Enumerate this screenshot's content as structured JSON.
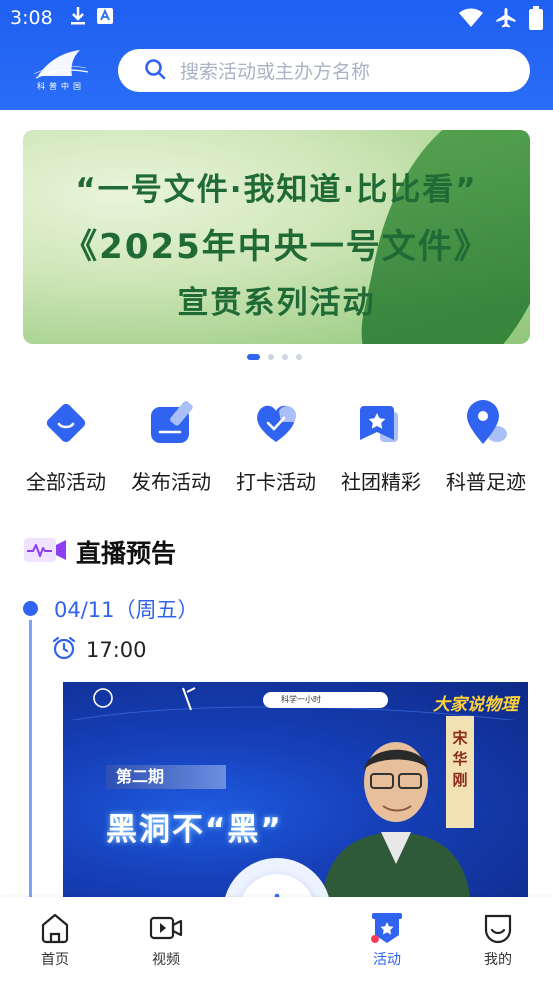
{
  "status_bar": {
    "time": "3:08"
  },
  "header": {
    "logo_text": "科普中国",
    "search": {
      "placeholder": "搜索活动或主办方名称"
    }
  },
  "banner": {
    "lines": [
      "“一号文件·我知道·比比看”",
      "《2025年中央一号文件》",
      "宣贯系列活动"
    ],
    "page_count": 4,
    "active_index": 0
  },
  "quick_nav": [
    {
      "label": "全部活动",
      "icon": "diamond-smile-icon"
    },
    {
      "label": "发布活动",
      "icon": "publish-edit-icon"
    },
    {
      "label": "打卡活动",
      "icon": "heart-checkin-icon"
    },
    {
      "label": "社团精彩",
      "icon": "star-badge-icon"
    },
    {
      "label": "科普足迹",
      "icon": "location-pin-icon"
    }
  ],
  "live_section": {
    "title": "直播预告",
    "items": [
      {
        "date": "04/11（周五）",
        "time": "17:00",
        "card": {
          "series_title": "大家说物理",
          "episode": "第二期",
          "topic": "黑洞不“黑”",
          "speaker": "宋华刚",
          "search_chip": "科学一小时"
        }
      }
    ]
  },
  "bottom_nav": {
    "tabs": [
      {
        "label": "首页",
        "icon": "home-icon"
      },
      {
        "label": "视频",
        "icon": "video-icon"
      },
      {
        "label": "活动",
        "icon": "activity-badge-icon",
        "active": true
      },
      {
        "label": "我的",
        "icon": "profile-icon"
      }
    ]
  },
  "colors": {
    "brand": "#2f63f0",
    "header": "#2a6df6"
  }
}
